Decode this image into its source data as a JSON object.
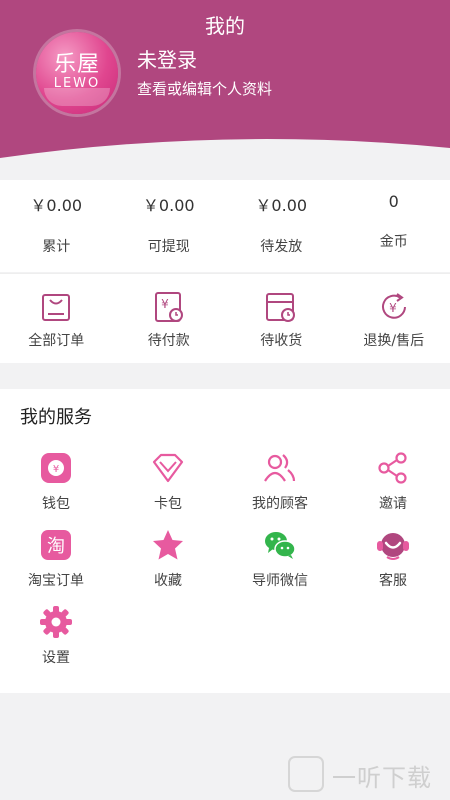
{
  "header": {
    "title": "我的",
    "login_status": "未登录",
    "profile_hint": "查看或编辑个人资料",
    "avatar": {
      "brand_cn": "乐屋",
      "brand_en": "LEWO"
    }
  },
  "stats": [
    {
      "value": "￥0.00",
      "label": "累计"
    },
    {
      "value": "￥0.00",
      "label": "可提现"
    },
    {
      "value": "￥0.00",
      "label": "待发放"
    },
    {
      "value": "0",
      "label": "金币"
    }
  ],
  "orders": [
    {
      "label": "全部订单",
      "icon": "shopping-bag-icon"
    },
    {
      "label": "待付款",
      "icon": "payment-icon"
    },
    {
      "label": "待收货",
      "icon": "delivery-icon"
    },
    {
      "label": "退换/售后",
      "icon": "refund-icon"
    }
  ],
  "services": {
    "title": "我的服务",
    "items": [
      {
        "label": "钱包",
        "icon": "wallet-icon"
      },
      {
        "label": "卡包",
        "icon": "diamond-icon"
      },
      {
        "label": "我的顾客",
        "icon": "customers-icon"
      },
      {
        "label": "邀请",
        "icon": "share-icon"
      },
      {
        "label": "淘宝订单",
        "icon": "taobao-icon"
      },
      {
        "label": "收藏",
        "icon": "star-icon"
      },
      {
        "label": "导师微信",
        "icon": "wechat-icon"
      },
      {
        "label": "客服",
        "icon": "headset-icon"
      },
      {
        "label": "设置",
        "icon": "gear-icon"
      }
    ]
  },
  "watermark": {
    "text": "一听下载"
  },
  "colors": {
    "header": "#b0477f",
    "accent": "#e75a9f",
    "wechat": "#33b54c"
  }
}
